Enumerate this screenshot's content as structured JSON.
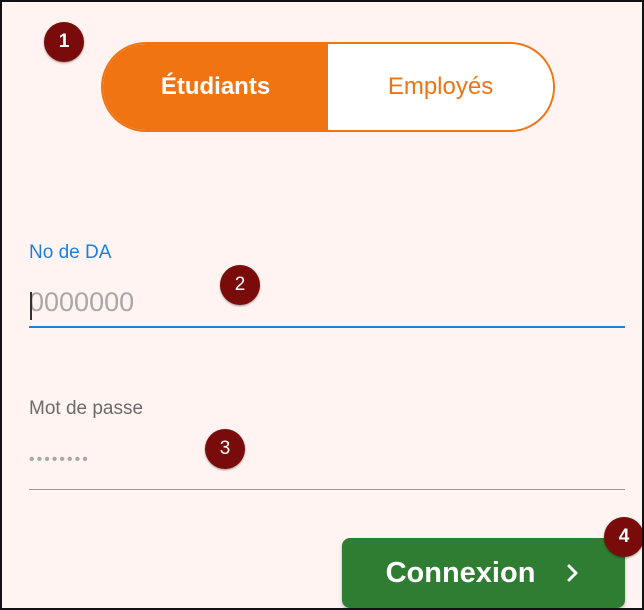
{
  "toggle": {
    "students_label": "Étudiants",
    "employees_label": "Employés",
    "selected": "Étudiants"
  },
  "da_field": {
    "label": "No de DA",
    "placeholder": "0000000",
    "value": ""
  },
  "password_field": {
    "label": "Mot de passe",
    "placeholder": "••••••••",
    "value": ""
  },
  "login_button": {
    "label": "Connexion",
    "icon": "chevron-right-icon"
  },
  "annotations": [
    "1",
    "2",
    "3",
    "4"
  ],
  "colors": {
    "accent_orange": "#f07412",
    "focus_blue": "#1e7fd6",
    "button_green": "#2e7d32",
    "badge_red": "#7a0b0b",
    "background": "#fff4f2"
  }
}
